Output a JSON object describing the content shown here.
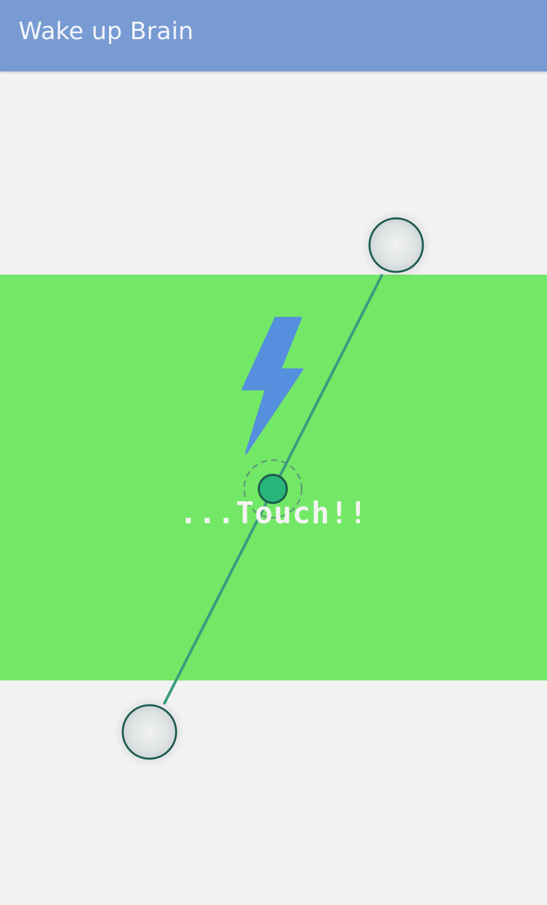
{
  "app": {
    "title": "Wake up Brain"
  },
  "main": {
    "touch_label": "...Touch!!",
    "icon": "lightning-bolt-icon"
  },
  "colors": {
    "toolbar": "#789bd3",
    "background": "#f2f2f2",
    "band": "#72e866",
    "bolt": "#558fdd",
    "line": "#3b9a7f",
    "handle_border": "#1f5b52",
    "center_dot": "#27b57a"
  }
}
